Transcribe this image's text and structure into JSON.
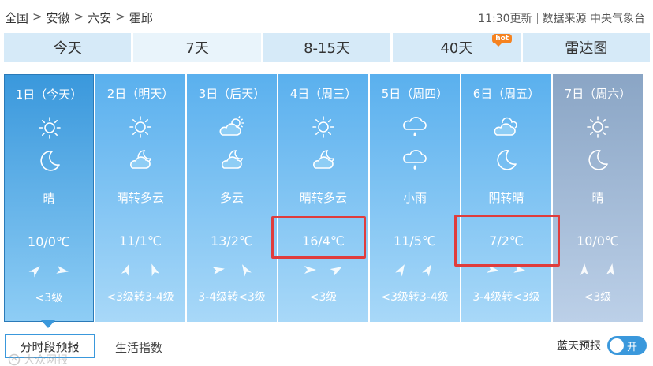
{
  "breadcrumb": {
    "items": [
      "全国",
      "安徽",
      "六安",
      "霍邱"
    ],
    "separator": ">"
  },
  "meta": {
    "update": "11:30更新",
    "source": "数据来源 中央气象台"
  },
  "tabs": [
    {
      "label": "今天"
    },
    {
      "label": "7天",
      "active": true
    },
    {
      "label": "8-15天"
    },
    {
      "label": "40天",
      "badge": "hot"
    },
    {
      "label": "雷达图"
    }
  ],
  "days": [
    {
      "date": "1日（今天）",
      "day_icon": "sun-icon",
      "night_icon": "moon-icon",
      "weather": "晴",
      "temp": "10/0℃",
      "wind": "<3级"
    },
    {
      "date": "2日（明天）",
      "day_icon": "sun-icon",
      "night_icon": "partly-cloudy-night-icon",
      "weather": "晴转多云",
      "temp": "11/1℃",
      "wind": "<3级转3-4级"
    },
    {
      "date": "3日（后天）",
      "day_icon": "partly-cloudy-icon",
      "night_icon": "partly-cloudy-night-icon",
      "weather": "多云",
      "temp": "13/2℃",
      "wind": "3-4级转<3级"
    },
    {
      "date": "4日（周三）",
      "day_icon": "sun-icon",
      "night_icon": "partly-cloudy-night-icon",
      "weather": "晴转多云",
      "temp": "16/4℃",
      "wind": "<3级",
      "highlighted": true
    },
    {
      "date": "5日（周四）",
      "day_icon": "rain-icon",
      "night_icon": "rain-icon",
      "weather": "小雨",
      "temp": "11/5℃",
      "wind": "<3级转3-4级"
    },
    {
      "date": "6日（周五）",
      "day_icon": "cloudy-icon",
      "night_icon": "moon-icon",
      "weather": "阴转晴",
      "temp": "7/2℃",
      "wind": "3-4级转<3级",
      "highlighted": true
    },
    {
      "date": "7日（周六）",
      "day_icon": "sun-icon",
      "night_icon": "moon-icon",
      "weather": "晴",
      "temp": "10/0℃",
      "wind": "<3级"
    }
  ],
  "bottom": {
    "hourly": "分时段预报",
    "life": "生活指数",
    "bluesky": "蓝天预报",
    "toggle": "开",
    "watermark": "大众网报"
  },
  "colors": {
    "accent": "#3a98dc",
    "tab_bg": "#d6eaf8",
    "highlight": "#e03c3c",
    "hot": "#f58220"
  }
}
